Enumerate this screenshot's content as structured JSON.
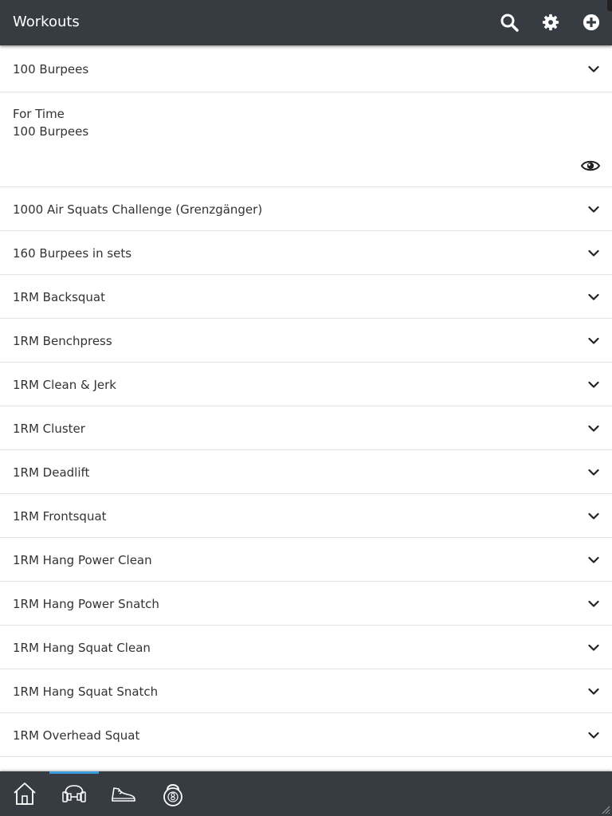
{
  "header": {
    "title": "Workouts",
    "icons": [
      "search-icon",
      "gear-icon",
      "add-circle-icon"
    ]
  },
  "expanded_workout": {
    "title": "100 Burpees",
    "description_lines": [
      "For Time",
      "100 Burpees"
    ]
  },
  "workouts": [
    "1000 Air Squats Challenge (Grenzgänger)",
    "160 Burpees in sets",
    "1RM Backsquat",
    "1RM Benchpress",
    "1RM Clean & Jerk",
    "1RM Cluster",
    "1RM Deadlift",
    "1RM Frontsquat",
    "1RM Hang Power Clean",
    "1RM Hang Power Snatch",
    "1RM Hang Squat Clean",
    "1RM Hang Squat Snatch",
    "1RM Overhead Squat"
  ],
  "tabs": [
    {
      "icon": "home-icon",
      "active": false
    },
    {
      "icon": "workout-icon",
      "active": true
    },
    {
      "icon": "running-shoe-icon",
      "active": false
    },
    {
      "icon": "kettlebell-icon",
      "active": false
    }
  ],
  "colors": {
    "bar_background": "#373c42",
    "active_tab_indicator": "#3b9ad9",
    "divider": "#e3e3e3"
  }
}
